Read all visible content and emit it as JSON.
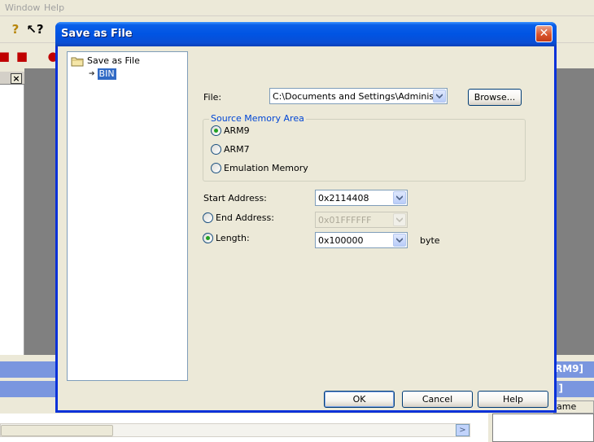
{
  "background_app": {
    "menu": [
      "Window",
      "Help"
    ],
    "strip_label_1": "RM9]",
    "strip_label_2": "]",
    "column_header": "ame"
  },
  "dialog": {
    "title": "Save as File",
    "tree": {
      "root_label": "Save as File",
      "child_label": "BIN"
    },
    "file": {
      "label": "File:",
      "value": "C:\\Documents and Settings\\Administrator",
      "browse_label": "Browse..."
    },
    "source_memory_area": {
      "legend": "Source Memory Area",
      "options": [
        "ARM9",
        "ARM7",
        "Emulation Memory"
      ],
      "selected": "ARM9"
    },
    "start_address": {
      "label": "Start Address:",
      "value": "0x2114408"
    },
    "end_address": {
      "label": "End Address:",
      "value": "0x01FFFFFF",
      "enabled": false,
      "selected": false
    },
    "length": {
      "label": "Length:",
      "value": "0x100000",
      "unit": "byte",
      "selected": true
    },
    "buttons": {
      "ok": "OK",
      "cancel": "Cancel",
      "help": "Help"
    }
  },
  "colors": {
    "title_bar": "#0054e3",
    "selection": "#316ac5",
    "group_legend": "#0046d5",
    "radio_dot": "#21a121"
  }
}
